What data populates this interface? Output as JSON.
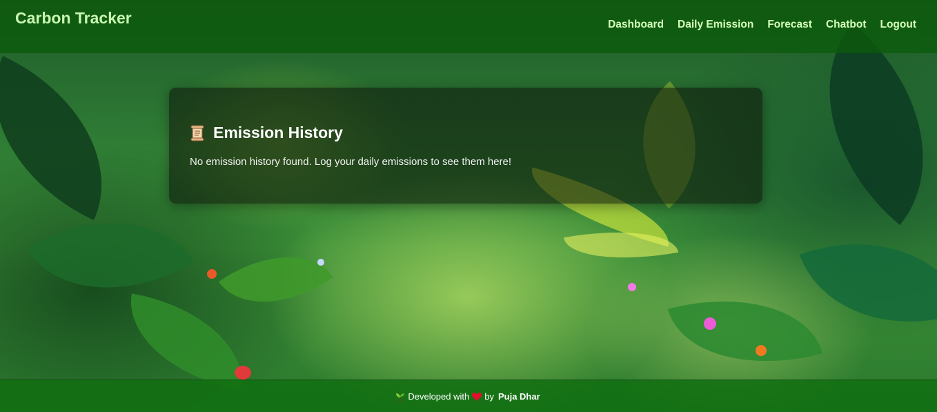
{
  "app": {
    "brand": "Carbon Tracker"
  },
  "nav": {
    "items": [
      {
        "label": "Dashboard"
      },
      {
        "label": "Daily Emission"
      },
      {
        "label": "Forecast"
      },
      {
        "label": "Chatbot"
      },
      {
        "label": "Logout"
      }
    ]
  },
  "history": {
    "title": "Emission History",
    "icon": "scroll-icon",
    "empty_message": "No emission history found. Log your daily emissions to see them here!"
  },
  "footer": {
    "prefix": "Developed with",
    "middle": "by",
    "author": "Puja Dhar",
    "icons": [
      "sprout-icon",
      "heart-icon"
    ],
    "heart_color": "#e0102a"
  },
  "colors": {
    "navbar": "#0c5a0c",
    "footer": "#106e10",
    "brand_text": "#c9f7b0",
    "nav_text": "#d6ffb8"
  }
}
